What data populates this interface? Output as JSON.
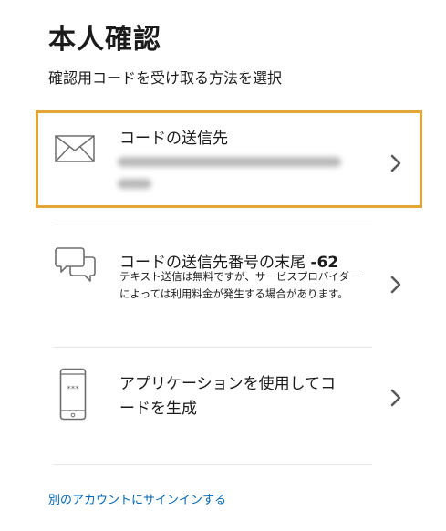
{
  "header": {
    "title": "本人確認",
    "subtitle": "確認用コードを受け取る方法を選択"
  },
  "options": [
    {
      "title": "コードの送信先",
      "detail_redacted": true,
      "icon": "envelope-icon",
      "selected": true
    },
    {
      "title_prefix": "コードの送信先番号の末尾 ",
      "title_suffix": "-62",
      "description": "テキスト送信は無料ですが、サービスプロバイダーによっては利用料金が発生する場合があります。",
      "icon": "sms-chat-icon"
    },
    {
      "title_line1": "アプリケーションを使用してコ",
      "title_line2": "ードを生成",
      "icon": "smartphone-icon",
      "icon_text": "***"
    }
  ],
  "footer": {
    "switch_account_link": "別のアカウントにサインインする"
  },
  "colors": {
    "selected_border": "#e4a534",
    "link": "#0067b8",
    "icon_stroke": "#6e6e6e"
  }
}
